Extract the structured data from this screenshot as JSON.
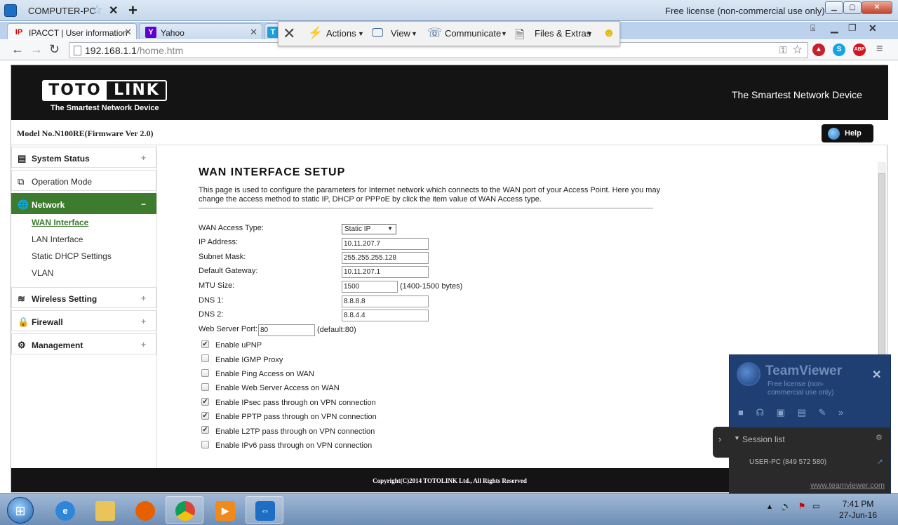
{
  "remote": {
    "computer_name": "COMPUTER-PC",
    "license_note": "Free license (non-commercial use only)",
    "win_min": "▁",
    "win_max": "▢",
    "win_close": "✕"
  },
  "browser": {
    "tabs": [
      {
        "icon": "IP",
        "label": "IPACCT | User information"
      },
      {
        "icon": "Y",
        "label": "Yahoo"
      },
      {
        "icon": "T",
        "label": ""
      }
    ],
    "url_host": "192.168.1.1",
    "url_path": "/home.htm"
  },
  "tv_toolbar": {
    "actions": "Actions",
    "view": "View",
    "communicate": "Communicate",
    "files": "Files & Extras"
  },
  "router": {
    "brand_left": "TOTO",
    "brand_right": "LINK",
    "tagline": "The Smartest Network Device",
    "tagline_right": "The Smartest Network Device",
    "model": "Model No.N100RE(Firmware Ver 2.0)",
    "help": "Help",
    "footer": "Copyright(C)2014 TOTOLINK Ltd., All Rights Reserved"
  },
  "sidebar": {
    "system_status": "System Status",
    "operation_mode": "Operation Mode",
    "network": "Network",
    "network_sub": [
      "WAN Interface",
      "LAN Interface",
      "Static DHCP Settings",
      "VLAN"
    ],
    "wireless": "Wireless Setting",
    "firewall": "Firewall",
    "management": "Management"
  },
  "wan": {
    "title": "WAN INTERFACE SETUP",
    "description": "This page is used to configure the parameters for Internet network which connects to the WAN port of your Access Point. Here you may change the access method to static IP, DHCP or PPPoE by click the item value of WAN Access type.",
    "access_type_label": "WAN Access Type:",
    "access_type_value": "Static IP",
    "ip_label": "IP Address:",
    "ip_value": "10.11.207.7",
    "mask_label": "Subnet Mask:",
    "mask_value": "255.255.255.128",
    "gw_label": "Default Gateway:",
    "gw_value": "10.11.207.1",
    "mtu_label": "MTU Size:",
    "mtu_value": "1500",
    "mtu_note": "(1400-1500 bytes)",
    "dns1_label": "DNS 1:",
    "dns1_value": "8.8.8.8",
    "dns2_label": "DNS 2:",
    "dns2_value": "8.8.4.4",
    "port_label": "Web Server Port:",
    "port_value": "80",
    "port_note": "(default:80)",
    "options": [
      {
        "label": "Enable uPNP",
        "checked": true
      },
      {
        "label": "Enable IGMP Proxy",
        "checked": false
      },
      {
        "label": "Enable Ping Access on WAN",
        "checked": false
      },
      {
        "label": "Enable Web Server Access on WAN",
        "checked": false
      },
      {
        "label": "Enable IPsec pass through on VPN connection",
        "checked": true
      },
      {
        "label": "Enable PPTP pass through on VPN connection",
        "checked": true
      },
      {
        "label": "Enable L2TP pass through on VPN connection",
        "checked": true
      },
      {
        "label": "Enable IPv6 pass through on VPN connection",
        "checked": false
      }
    ]
  },
  "teamviewer": {
    "name": "TeamViewer",
    "license": "Free license (non-commercial use only)",
    "session_list": "Session list",
    "session": "USER-PC (849 572 580)",
    "url": "www.teamviewer.com"
  },
  "taskbar": {
    "time": "7:41 PM",
    "date": "27-Jun-16"
  }
}
